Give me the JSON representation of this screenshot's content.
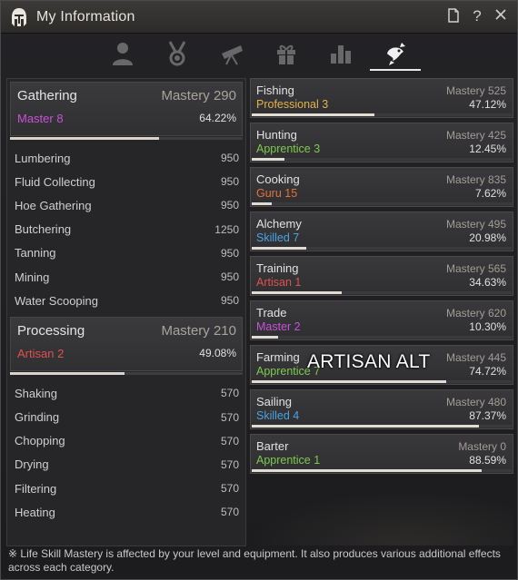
{
  "window": {
    "title": "My Information"
  },
  "title_buttons": {
    "page": "🗋",
    "help": "?",
    "close": "✕"
  },
  "tabs": [
    {
      "icon": "character-icon",
      "active": false
    },
    {
      "icon": "medal-icon",
      "active": false
    },
    {
      "icon": "telescope-icon",
      "active": false
    },
    {
      "icon": "gift-icon",
      "active": false
    },
    {
      "icon": "bar-chart-icon",
      "active": false
    },
    {
      "icon": "life-skill-icon",
      "active": true
    }
  ],
  "gathering": {
    "title": "Gathering",
    "mastery": "Mastery 290",
    "grade": "Master 8",
    "grade_color": "#c752d6",
    "percent": "64.22%",
    "progress": 0.6422,
    "items": [
      {
        "label": "Lumbering",
        "value": "950"
      },
      {
        "label": "Fluid Collecting",
        "value": "950"
      },
      {
        "label": "Hoe Gathering",
        "value": "950"
      },
      {
        "label": "Butchering",
        "value": "1250"
      },
      {
        "label": "Tanning",
        "value": "950"
      },
      {
        "label": "Mining",
        "value": "950"
      },
      {
        "label": "Water Scooping",
        "value": "950"
      }
    ]
  },
  "processing": {
    "title": "Processing",
    "mastery": "Mastery 210",
    "grade": "Artisan 2",
    "grade_color": "#e05050",
    "percent": "49.08%",
    "progress": 0.4908,
    "items": [
      {
        "label": "Shaking",
        "value": "570"
      },
      {
        "label": "Grinding",
        "value": "570"
      },
      {
        "label": "Chopping",
        "value": "570"
      },
      {
        "label": "Drying",
        "value": "570"
      },
      {
        "label": "Filtering",
        "value": "570"
      },
      {
        "label": "Heating",
        "value": "570"
      }
    ]
  },
  "skills": [
    {
      "name": "Fishing",
      "mastery": "Mastery 525",
      "grade": "Professional 3",
      "grade_color": "#e2b24a",
      "percent": "47.12%",
      "progress": 0.4712
    },
    {
      "name": "Hunting",
      "mastery": "Mastery 425",
      "grade": "Apprentice 3",
      "grade_color": "#7dcb4e",
      "percent": "12.45%",
      "progress": 0.1245
    },
    {
      "name": "Cooking",
      "mastery": "Mastery 835",
      "grade": "Guru 15",
      "grade_color": "#e0743a",
      "percent": "7.62%",
      "progress": 0.0762
    },
    {
      "name": "Alchemy",
      "mastery": "Mastery 495",
      "grade": "Skilled 7",
      "grade_color": "#4aa3e0",
      "percent": "20.98%",
      "progress": 0.2098
    },
    {
      "name": "Training",
      "mastery": "Mastery 565",
      "grade": "Artisan 1",
      "grade_color": "#e05050",
      "percent": "34.63%",
      "progress": 0.3463
    },
    {
      "name": "Trade",
      "mastery": "Mastery 620",
      "grade": "Master 2",
      "grade_color": "#c752d6",
      "percent": "10.30%",
      "progress": 0.103
    },
    {
      "name": "Farming",
      "mastery": "Mastery 445",
      "grade": "Apprentice 7",
      "grade_color": "#7dcb4e",
      "percent": "74.72%",
      "progress": 0.7472
    },
    {
      "name": "Sailing",
      "mastery": "Mastery 480",
      "grade": "Skilled 4",
      "grade_color": "#4aa3e0",
      "percent": "87.37%",
      "progress": 0.8737
    },
    {
      "name": "Barter",
      "mastery": "Mastery 0",
      "grade": "Apprentice 1",
      "grade_color": "#7dcb4e",
      "percent": "88.59%",
      "progress": 0.8859
    }
  ],
  "watermark": "ARTISAN ALT",
  "footer": "※ Life Skill Mastery is affected by your level and equipment. It also produces various additional effects across each category."
}
